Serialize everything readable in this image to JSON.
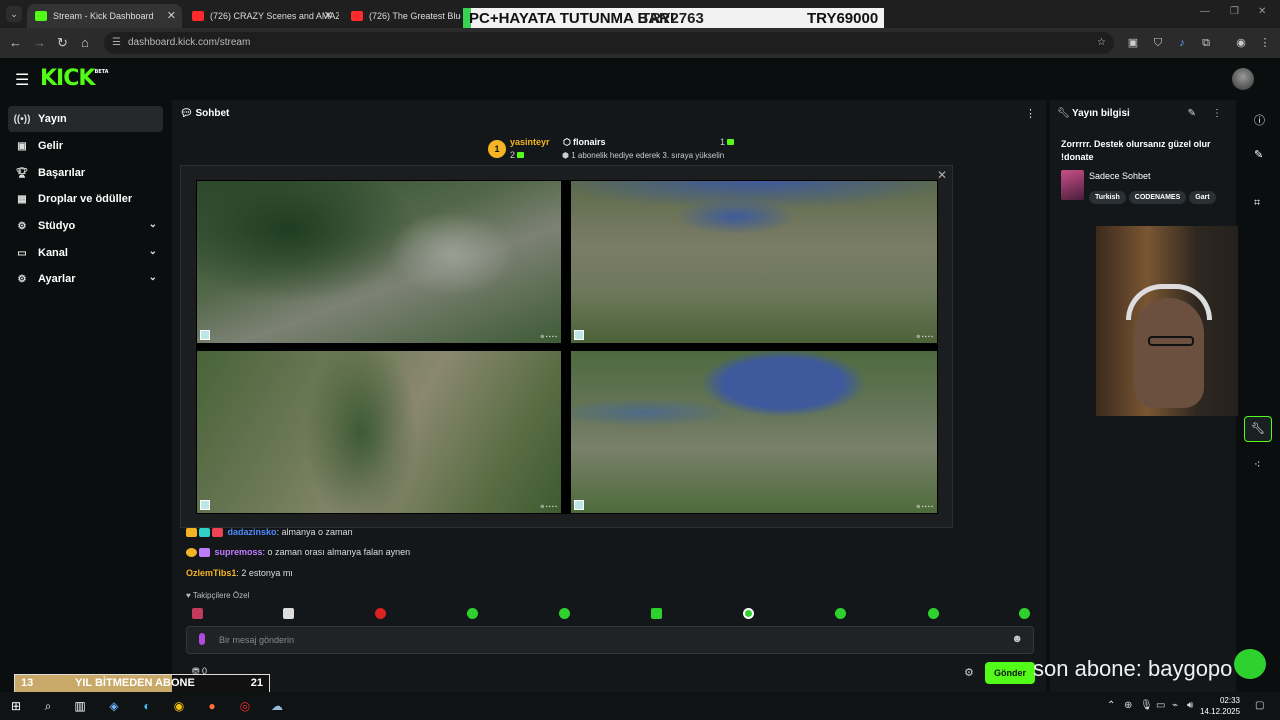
{
  "browser": {
    "tabs": [
      {
        "label": "Stream - Kick Dashboard",
        "active": true
      },
      {
        "label": "(726) CRAZY Scenes and AMAZ"
      },
      {
        "label": "(726) The Greatest Blues Ba"
      }
    ],
    "url": "dashboard.kick.com/stream"
  },
  "overlay_top": {
    "left_text": "PC+HAYATA TUTUNMA BARI",
    "mid_text": "TRY2763",
    "right_text": "TRY69000"
  },
  "kick": {
    "logo": "KICK",
    "logo_sup": "BETA"
  },
  "sidebar": {
    "items": [
      {
        "label": "Yayın",
        "icon": "broadcast-icon",
        "active": true
      },
      {
        "label": "Gelir",
        "icon": "revenue-icon"
      },
      {
        "label": "Başarılar",
        "icon": "trophy-icon"
      },
      {
        "label": "Droplar ve ödüller",
        "icon": "gift-icon"
      },
      {
        "label": "Stüdyo",
        "icon": "studio-icon",
        "expandable": true
      },
      {
        "label": "Kanal",
        "icon": "channel-icon",
        "expandable": true
      },
      {
        "label": "Ayarlar",
        "icon": "settings-icon",
        "expandable": true
      }
    ]
  },
  "chat": {
    "title": "Sohbet",
    "pinned": {
      "rank": "1",
      "user": "yasinteyr",
      "count": "2",
      "user2": "flonairs",
      "right_count": "1",
      "message": "1 abonelik hediye ederek 3. sıraya yükselin"
    },
    "messages": [
      {
        "user": "dadazinsko",
        "text": ": almanya o zaman",
        "color": "#4c8cff"
      },
      {
        "user": "supremoss",
        "text": ": o zaman orası almanya falan aynen",
        "color": "#c07cff"
      },
      {
        "user": "OzlemTibs1",
        "text": ": 2 estonya mı",
        "color": "#f5b423"
      }
    ],
    "followers_label": "Takipçilere Özel",
    "input_placeholder": "Bir mesaj gönderin",
    "send_label": "Gönder",
    "points": "0"
  },
  "right_panel": {
    "title": "Yayın bilgisi",
    "stream_title": "Zorrrrr. Destek olursanız güzel olur !donate",
    "category": "Sadece Sohbet",
    "tags": [
      "Turkish",
      "CODENAMES",
      "Gart"
    ]
  },
  "overlays": {
    "sub_banner": "son abone: baygopo",
    "goal_left": "13",
    "goal_label": "YIL BİTMEDEN ABONE",
    "goal_right": "21",
    "goal_progress": 0.62
  },
  "taskbar": {
    "time": "02:33",
    "date": "14.12.2025"
  },
  "colors": {
    "kick_green": "#53fc18",
    "panel": "#141719",
    "bg": "#0b0e0f"
  }
}
